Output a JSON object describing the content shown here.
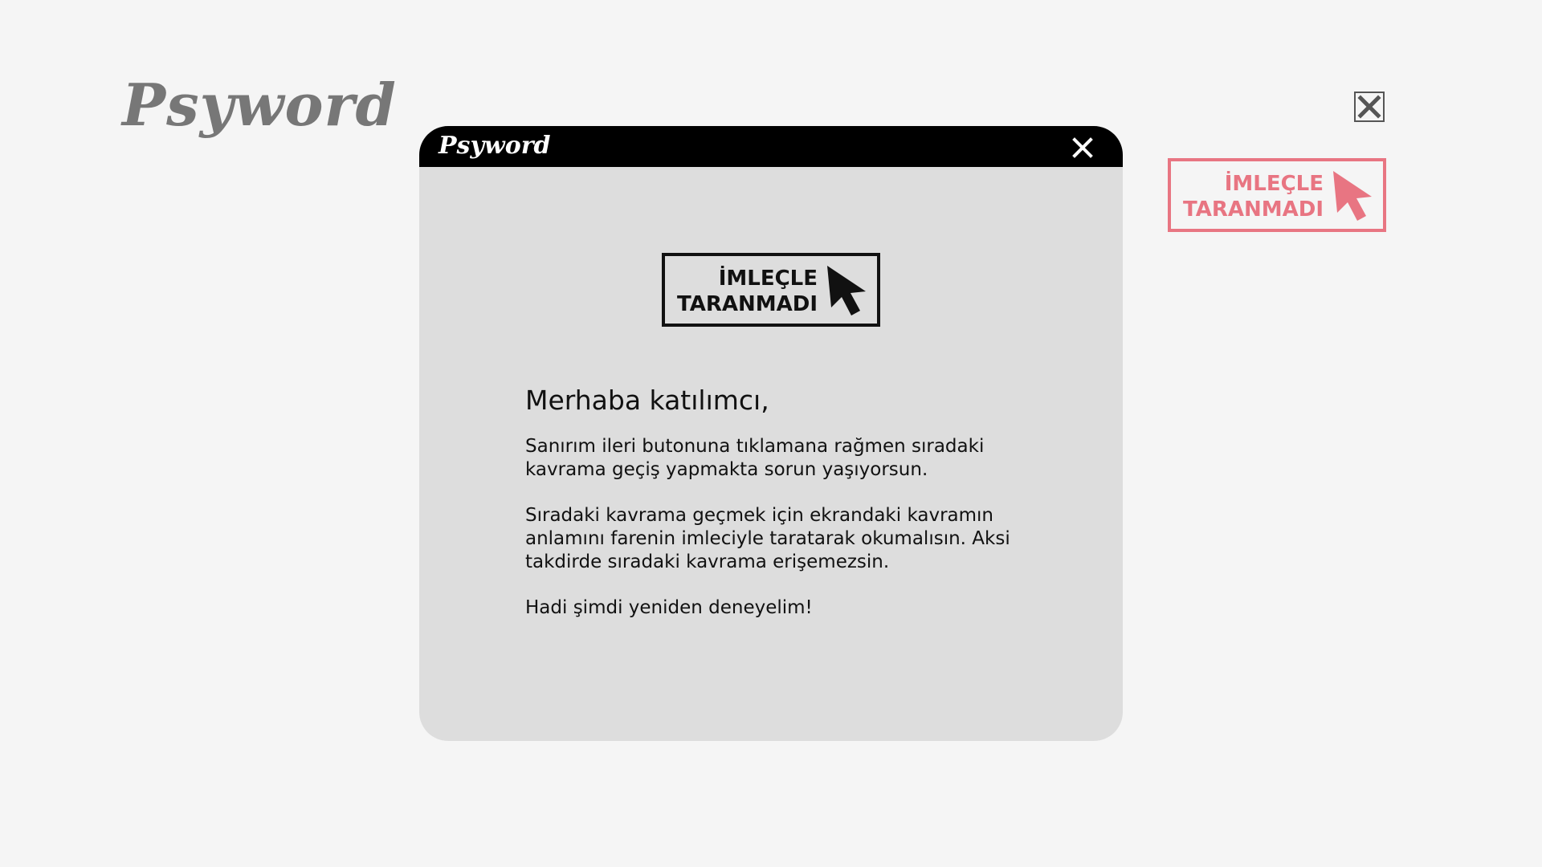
{
  "page": {
    "logo": "Psyword",
    "close_icon": "close-icon",
    "background": "#f5f5f5"
  },
  "badge": {
    "line1": "İMLEÇLE",
    "line2": "TARANMADI",
    "color": "#e87582",
    "icon": "cursor-arrow-icon"
  },
  "dialog": {
    "logo": "Psyword",
    "close_icon": "close-icon",
    "titlebar_color": "#000000",
    "background": "#dddddd",
    "badge": {
      "line1": "İMLEÇLE",
      "line2": "TARANMADI",
      "color": "#111111",
      "icon": "cursor-arrow-icon"
    },
    "heading": "Merhaba katılımcı,",
    "paragraphs": [
      "Sanırım ileri butonuna tıklamana rağmen sıradaki kavrama geçiş yapmakta sorun yaşıyorsun.",
      "Sıradaki kavrama geçmek için ekrandaki kavramın anlamını farenin imleciyle taratarak okumalısın. Aksi takdirde sıradaki kavrama erişemezsin.",
      "Hadi şimdi yeniden deneyelim!"
    ]
  }
}
